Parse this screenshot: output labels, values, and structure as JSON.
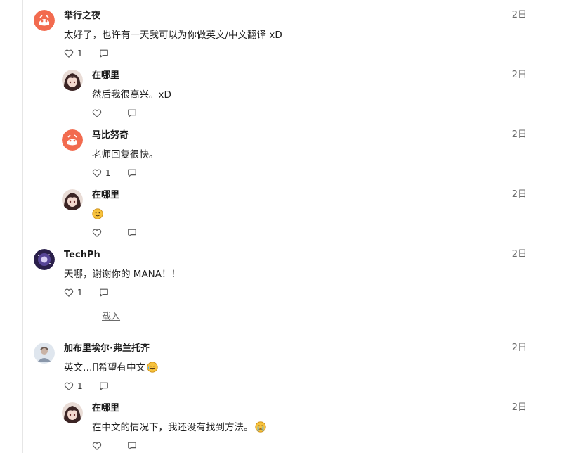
{
  "load_more": "载入",
  "comments": [
    {
      "user": "举行之夜",
      "time": "2日",
      "text": "太好了，也许有一天我可以为你做英文/中文翻译 xD",
      "likes": "1",
      "avatar": "orange-face-avatar",
      "level": 0
    },
    {
      "user": "在哪里",
      "time": "2日",
      "text": "然后我很高兴。xD",
      "likes": "",
      "avatar": "anime-girl-avatar",
      "level": 1
    },
    {
      "user": "马比努奇",
      "time": "2日",
      "text": "老师回复很快。",
      "likes": "1",
      "avatar": "orange-face-avatar",
      "level": 1
    },
    {
      "user": "在哪里",
      "time": "2日",
      "text": "",
      "emoji": "smiling-face-emoji",
      "likes": "",
      "avatar": "anime-girl-avatar",
      "level": 1
    },
    {
      "user": "TechPh",
      "time": "2日",
      "text": "天哪，谢谢你的 MANA！！",
      "likes": "1",
      "avatar": "galaxy-avatar",
      "level": 0
    },
    {
      "user": "加布里埃尔·弗兰托齐",
      "time": "2日",
      "text_before": "英文…",
      "text_after": "希望有中文",
      "emoji": "rolling-laughing-emoji",
      "likes": "1",
      "avatar": "person-photo-avatar",
      "level": 0
    },
    {
      "user": "在哪里",
      "time": "2日",
      "text": "在中文的情况下，我还没有找到方法。",
      "emoji": "crying-face-emoji",
      "likes": "",
      "avatar": "anime-girl-avatar",
      "level": 1
    }
  ],
  "colors": {
    "orange_avatar": "#f26b4f",
    "muted": "#6b6b6b",
    "border": "#e6e6e6"
  }
}
